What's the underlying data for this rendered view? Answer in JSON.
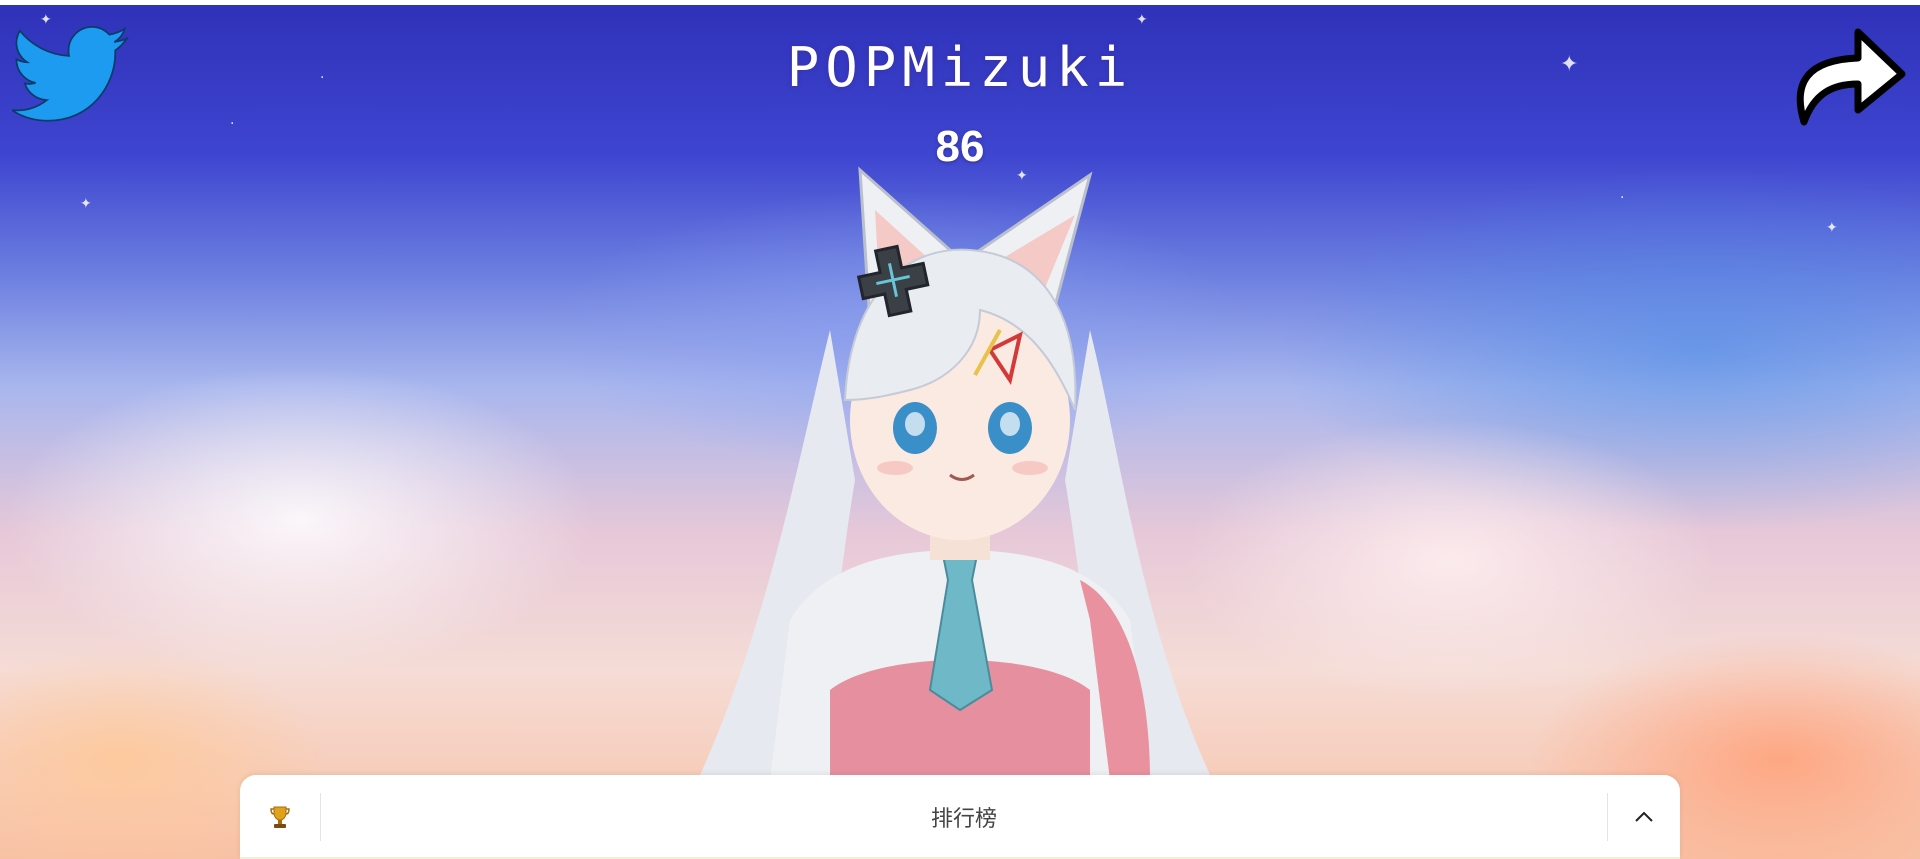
{
  "app": {
    "title": "POPMizuki",
    "score": "86"
  },
  "header": {
    "twitter_icon": "twitter-bird-icon",
    "share_icon": "share-arrow-icon",
    "twitter_color": "#1d9bf0"
  },
  "leaderboard": {
    "label": "排行榜",
    "trophy_icon": "trophy-icon",
    "toggle_icon": "chevron-up-icon"
  },
  "colors": {
    "sky_top": "#2f31b8",
    "sky_bottom": "#f8c1a4",
    "panel_bg": "#ffffff"
  }
}
